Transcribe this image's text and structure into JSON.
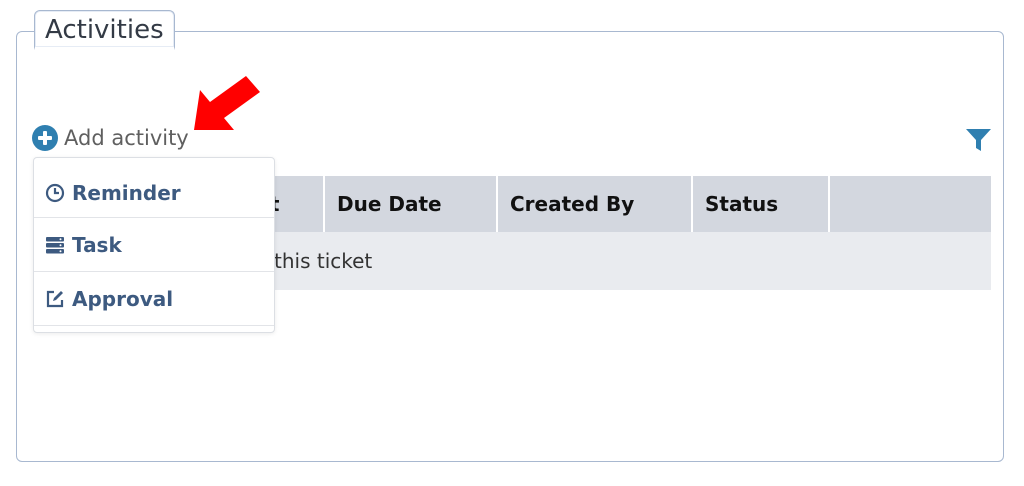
{
  "section": {
    "title": "Activities"
  },
  "toolbar": {
    "add_activity_label": "Add activity",
    "filter_icon": "filter-icon"
  },
  "table": {
    "columns": [
      "Subject",
      "Due Date",
      "Created By",
      "Status",
      ""
    ],
    "visible_header_fragment": "ct",
    "empty_message_fragment": "this ticket"
  },
  "dropdown": {
    "items": [
      {
        "label": "Reminder",
        "icon": "clock-icon"
      },
      {
        "label": "Task",
        "icon": "server-list-icon"
      },
      {
        "label": "Approval",
        "icon": "edit-square-icon"
      }
    ]
  },
  "colors": {
    "accent_blue": "#2f7fb0",
    "menu_text": "#3d5a80",
    "header_bg": "#d3d7df",
    "row_bg": "#e9ebef",
    "arrow_red": "#ff0000"
  }
}
